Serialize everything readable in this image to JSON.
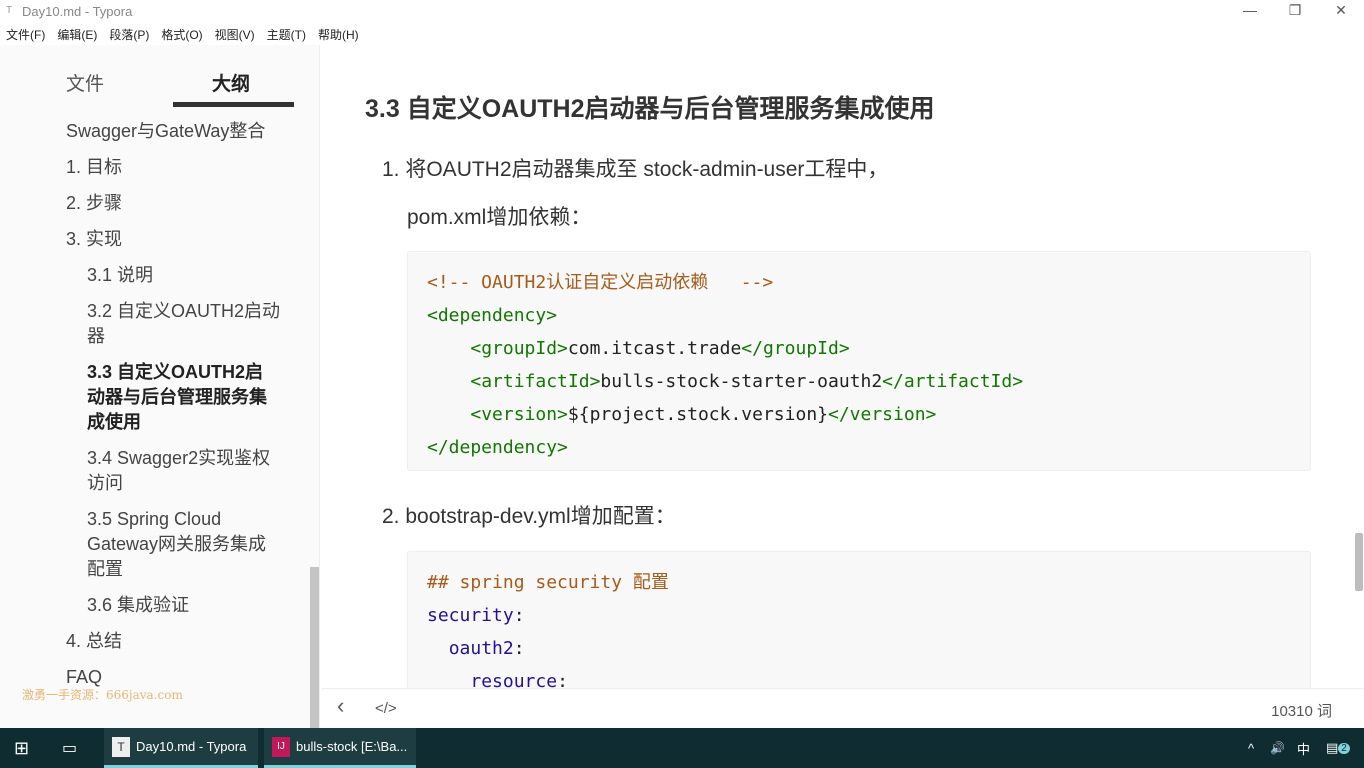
{
  "window": {
    "title": "Day10.md - Typora",
    "icon": "typora-icon",
    "minimize": "—",
    "restore": "❐",
    "close": "✕"
  },
  "menu": [
    "文件(F)",
    "编辑(E)",
    "段落(P)",
    "格式(O)",
    "视图(V)",
    "主题(T)",
    "帮助(H)"
  ],
  "sidebar": {
    "tabs": {
      "files": "文件",
      "outline": "大纲"
    },
    "outline": [
      {
        "label": "Swagger与GateWay整合",
        "level": 1
      },
      {
        "label": "1. 目标",
        "level": 1
      },
      {
        "label": "2. 步骤",
        "level": 1
      },
      {
        "label": "3. 实现",
        "level": 1
      },
      {
        "label": "3.1 说明",
        "level": 2
      },
      {
        "label": "3.2 自定义OAUTH2启动器",
        "level": 2
      },
      {
        "label": "3.3 自定义OAUTH2启动器与后台管理服务集成使用",
        "level": 2,
        "active": true
      },
      {
        "label": "3.4 Swagger2实现鉴权访问",
        "level": 2
      },
      {
        "label": "3.5 Spring Cloud Gateway网关服务集成配置",
        "level": 2
      },
      {
        "label": "3.6 集成验证",
        "level": 2
      },
      {
        "label": "4. 总结",
        "level": 1
      },
      {
        "label": "FAQ",
        "level": 1
      }
    ],
    "watermark": "激勇一手资源：666java.com"
  },
  "doc": {
    "heading": "3.3 自定义OAUTH2启动器与后台管理服务集成使用",
    "step1": "1. 将OAUTH2启动器集成至 stock-admin-user工程中，",
    "step1b": "pom.xml增加依赖：",
    "code1": [
      [
        [
          "<!-- OAUTH2认证自定义启动依赖   -->",
          "comment"
        ]
      ],
      [
        [
          "<dependency>",
          "tag"
        ]
      ],
      [
        [
          "    ",
          ""
        ],
        [
          "<groupId>",
          "tag"
        ],
        [
          "com.itcast.trade",
          "text"
        ],
        [
          "</groupId>",
          "tag"
        ]
      ],
      [
        [
          "    ",
          ""
        ],
        [
          "<artifactId>",
          "tag"
        ],
        [
          "bulls-stock-starter-oauth2",
          "text"
        ],
        [
          "</artifactId>",
          "tag"
        ]
      ],
      [
        [
          "    ",
          ""
        ],
        [
          "<version>",
          "tag"
        ],
        [
          "${project.stock.version}",
          "text"
        ],
        [
          "</version>",
          "tag"
        ]
      ],
      [
        [
          "</dependency>",
          "tag"
        ]
      ]
    ],
    "step2": "2. bootstrap-dev.yml增加配置：",
    "code2": [
      [
        [
          "## spring security 配置",
          "comment"
        ]
      ],
      [
        [
          "security",
          "key"
        ],
        [
          ":",
          "text"
        ]
      ],
      [
        [
          "  ",
          ""
        ],
        [
          "oauth2",
          "key"
        ],
        [
          ":",
          "text"
        ]
      ],
      [
        [
          "    ",
          ""
        ],
        [
          "resource",
          "key"
        ],
        [
          ":",
          "text"
        ]
      ]
    ]
  },
  "footer": {
    "back": "‹",
    "source": "</>",
    "word_count": "10310 词"
  },
  "taskbar": {
    "apps": [
      {
        "label": "Day10.md - Typora",
        "icon": "T"
      },
      {
        "label": "bulls-stock [E:\\Ba...",
        "icon": "IJ"
      }
    ],
    "tray": {
      "chevron": "^",
      "volume": "🔊",
      "ime": "中",
      "notifications": "2"
    }
  }
}
